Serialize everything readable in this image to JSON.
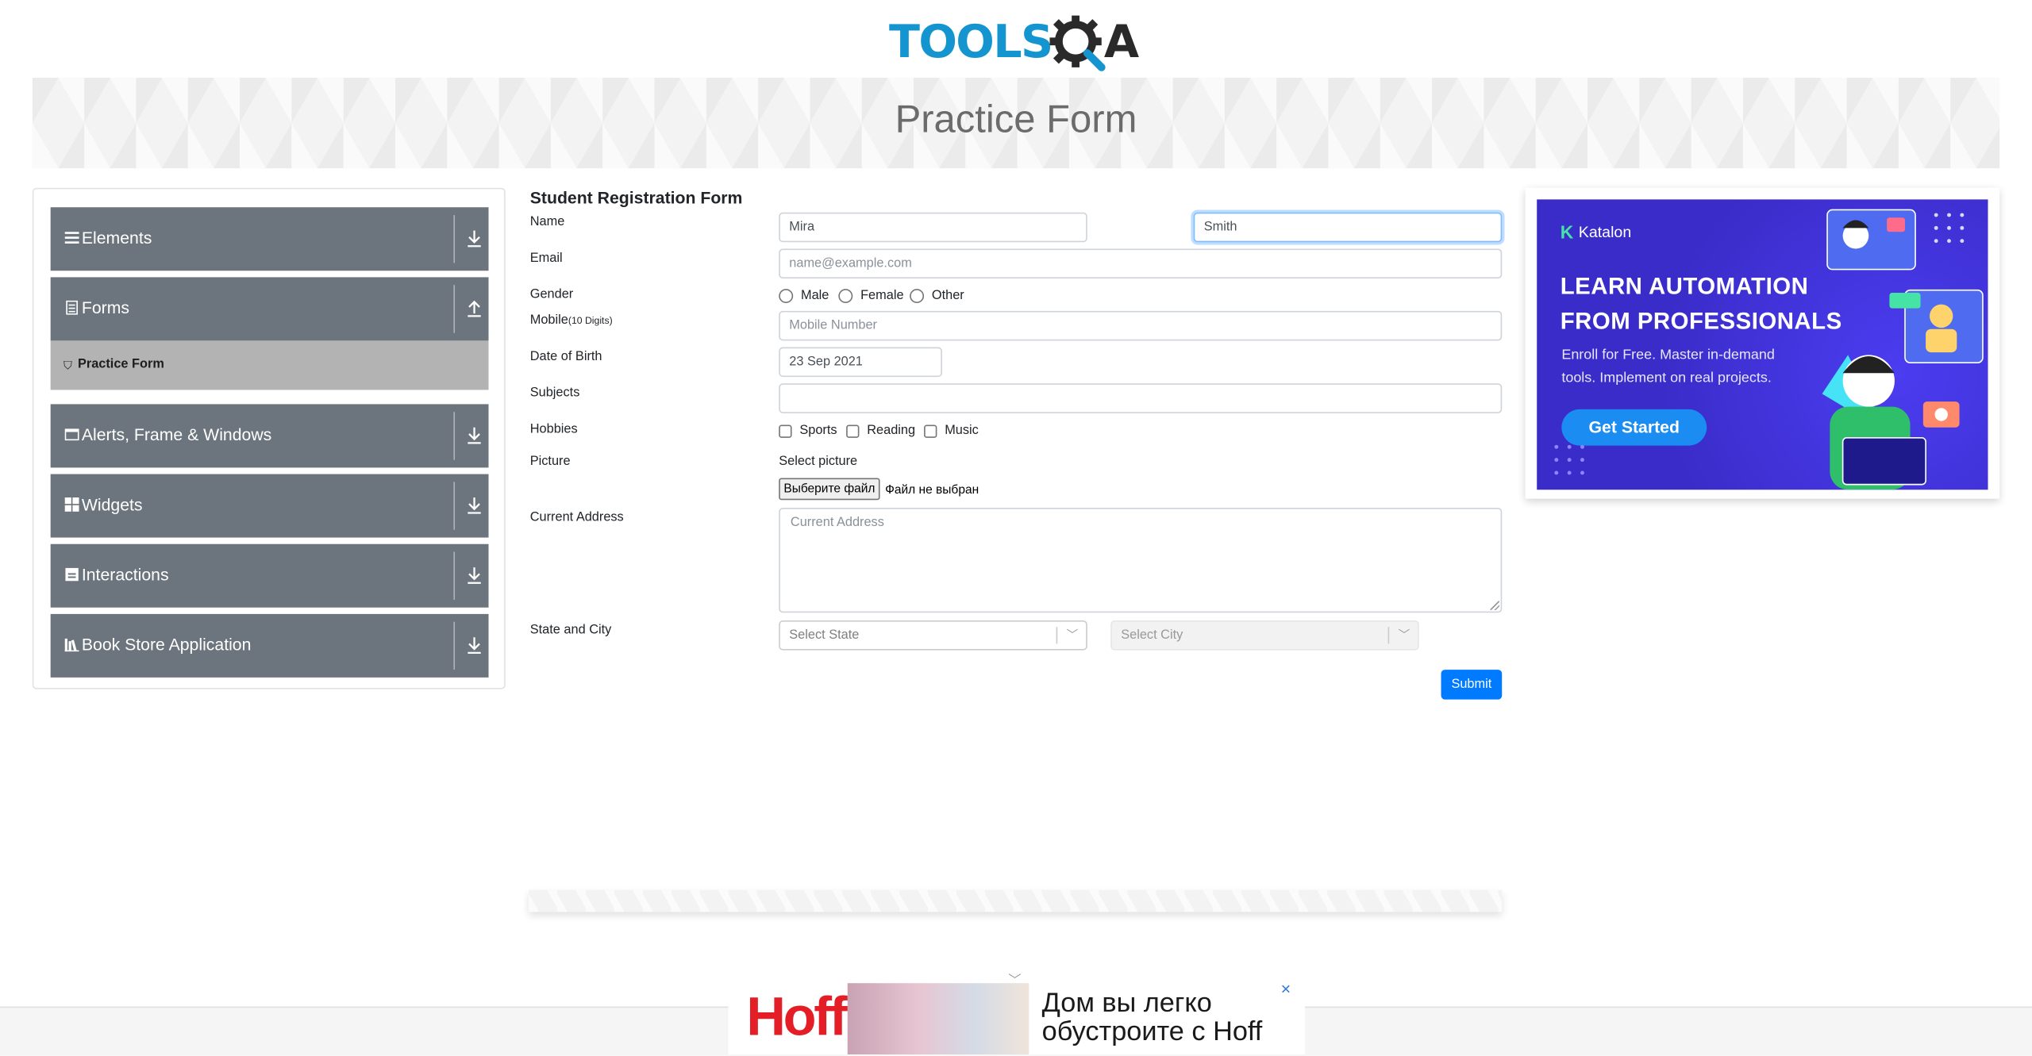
{
  "header": {
    "logo_part1": "TOOLS",
    "logo_part2": "A",
    "banner_title": "Practice Form"
  },
  "sidebar": {
    "groups": [
      {
        "label": "Elements",
        "icon": "hamburger-icon",
        "arrow": "download-arrow-icon"
      },
      {
        "label": "Forms",
        "icon": "form-icon",
        "arrow": "upload-arrow-icon"
      },
      {
        "label": "Alerts, Frame & Windows",
        "icon": "window-icon",
        "arrow": "download-arrow-icon"
      },
      {
        "label": "Widgets",
        "icon": "grid-icon",
        "arrow": "download-arrow-icon"
      },
      {
        "label": "Interactions",
        "icon": "interactions-icon",
        "arrow": "download-arrow-icon"
      },
      {
        "label": "Book Store Application",
        "icon": "bookstore-icon",
        "arrow": "download-arrow-icon"
      }
    ],
    "active_item": "Practice Form"
  },
  "form": {
    "title": "Student Registration Form",
    "labels": {
      "name": "Name",
      "email": "Email",
      "gender": "Gender",
      "mobile": "Mobile",
      "mobile_hint": "(10 Digits)",
      "dob": "Date of Birth",
      "subjects": "Subjects",
      "hobbies": "Hobbies",
      "picture": "Picture",
      "address": "Current Address",
      "state_city": "State and City"
    },
    "first_name": "Mira",
    "last_name": "Smith",
    "email_placeholder": "name@example.com",
    "genders": [
      "Male",
      "Female",
      "Other"
    ],
    "mobile_placeholder": "Mobile Number",
    "dob_value": "23 Sep 2021",
    "subjects_value": "",
    "hobbies": [
      "Sports",
      "Reading",
      "Music"
    ],
    "picture_label": "Select picture",
    "file_button": "Выберите файл",
    "file_status": "Файл не выбран",
    "address_placeholder": "Current Address",
    "state_placeholder": "Select State",
    "city_placeholder": "Select City",
    "submit_label": "Submit"
  },
  "ad": {
    "brand": "Katalon",
    "headline": "LEARN AUTOMATION FROM PROFESSIONALS",
    "subtext": "Enroll for Free. Master in-demand tools. Implement on real projects.",
    "cta": "Get Started"
  },
  "bottom_ad": {
    "brand": "Hoff",
    "text": "Дом вы легко обустроите с Hoff",
    "close": "✕"
  },
  "colors": {
    "accent": "#007bff",
    "sidebar_bg": "#6c757d",
    "active_item_bg": "#b3b3b3",
    "logo_blue": "#1595d0",
    "ad_bg": "#3d2fd2",
    "hoff_red": "#e41e26"
  }
}
